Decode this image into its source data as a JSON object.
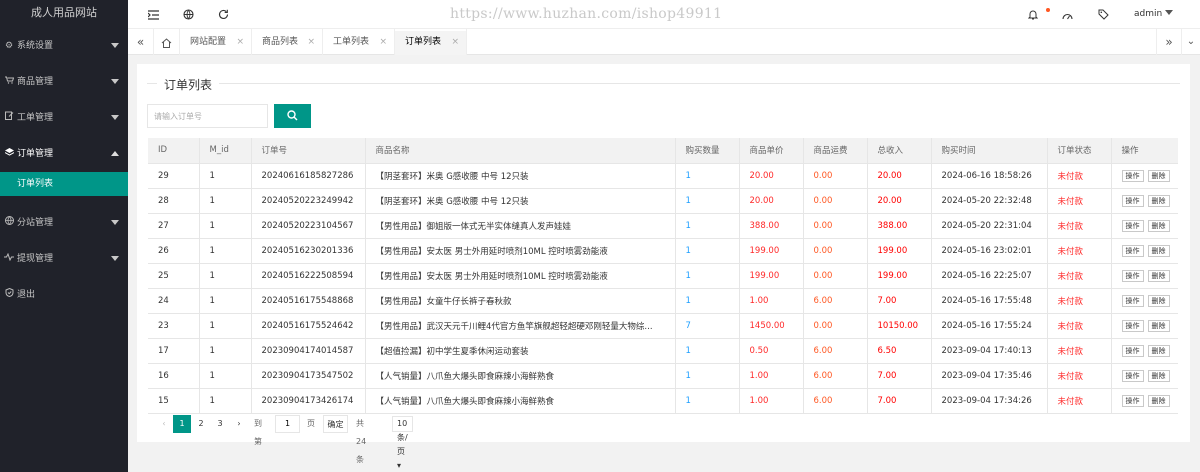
{
  "brand": "成人用品网站",
  "menu": {
    "items": [
      {
        "label": "系统设置",
        "icon": "gear-icon"
      },
      {
        "label": "商品管理",
        "icon": "cart-icon"
      },
      {
        "label": "工单管理",
        "icon": "edit-icon"
      },
      {
        "label": "订单管理",
        "icon": "layers-icon"
      },
      {
        "label": "分站管理",
        "icon": "globe-icon"
      },
      {
        "label": "提现管理",
        "icon": "pulse-icon"
      },
      {
        "label": "退出",
        "icon": "shield-icon"
      }
    ],
    "sub_active": "订单列表"
  },
  "header": {
    "watermark": "https://www.huzhan.com/ishop49911",
    "user": "admin"
  },
  "tabs": [
    {
      "label": "网站配置"
    },
    {
      "label": "商品列表"
    },
    {
      "label": "工单列表"
    },
    {
      "label": "订单列表"
    }
  ],
  "panel": {
    "legend": "订单列表",
    "search_placeholder": "请输入订单号"
  },
  "table": {
    "columns": [
      "ID",
      "M_id",
      "订单号",
      "商品名称",
      "购买数量",
      "商品单价",
      "商品运费",
      "总收入",
      "购买时间",
      "订单状态",
      "操作"
    ],
    "op_label": "操作",
    "del_label": "删除",
    "rows": [
      {
        "id": "29",
        "mid": "1",
        "order": "20240616185827286",
        "name": "【阴茎套环】米奥 G感收腰 中号 12只装",
        "qty": "1",
        "price": "20.00",
        "fee": "0.00",
        "total": "20.00",
        "time": "2024-06-16 18:58:26",
        "status": "未付款"
      },
      {
        "id": "28",
        "mid": "1",
        "order": "20240520223249942",
        "name": "【阴茎套环】米奥 G感收腰 中号 12只装",
        "qty": "1",
        "price": "20.00",
        "fee": "0.00",
        "total": "20.00",
        "time": "2024-05-20 22:32:48",
        "status": "未付款"
      },
      {
        "id": "27",
        "mid": "1",
        "order": "20240520223104567",
        "name": "【男性用品】御姐版一体式无半实体缝真人发声娃娃",
        "qty": "1",
        "price": "388.00",
        "fee": "0.00",
        "total": "388.00",
        "time": "2024-05-20 22:31:04",
        "status": "未付款"
      },
      {
        "id": "26",
        "mid": "1",
        "order": "20240516230201336",
        "name": "【男性用品】安太医 男士外用延时喷剂10ML 控时喷雾劲能液",
        "qty": "1",
        "price": "199.00",
        "fee": "0.00",
        "total": "199.00",
        "time": "2024-05-16 23:02:01",
        "status": "未付款"
      },
      {
        "id": "25",
        "mid": "1",
        "order": "20240516222508594",
        "name": "【男性用品】安太医 男士外用延时喷剂10ML 控时喷雾劲能液",
        "qty": "1",
        "price": "199.00",
        "fee": "0.00",
        "total": "199.00",
        "time": "2024-05-16 22:25:07",
        "status": "未付款"
      },
      {
        "id": "24",
        "mid": "1",
        "order": "20240516175548868",
        "name": "【男性用品】女童牛仔长裤子春秋款",
        "qty": "1",
        "price": "1.00",
        "fee": "6.00",
        "total": "7.00",
        "time": "2024-05-16 17:55:48",
        "status": "未付款"
      },
      {
        "id": "23",
        "mid": "1",
        "order": "20240516175524642",
        "name": "【男性用品】武汉天元千川鲤4代官方鱼竿旗舰超轻超硬邓刚轻量大物综...",
        "qty": "7",
        "price": "1450.00",
        "fee": "0.00",
        "total": "10150.00",
        "time": "2024-05-16 17:55:24",
        "status": "未付款"
      },
      {
        "id": "17",
        "mid": "1",
        "order": "20230904174014587",
        "name": "【超值捡漏】初中学生夏季休闲运动套装",
        "qty": "1",
        "price": "0.50",
        "fee": "6.00",
        "total": "6.50",
        "time": "2023-09-04 17:40:13",
        "status": "未付款"
      },
      {
        "id": "16",
        "mid": "1",
        "order": "20230904173547502",
        "name": "【人气销量】八爪鱼大爆头即食麻辣小海鲜熟食",
        "qty": "1",
        "price": "1.00",
        "fee": "6.00",
        "total": "7.00",
        "time": "2023-09-04 17:35:46",
        "status": "未付款"
      },
      {
        "id": "15",
        "mid": "1",
        "order": "20230904173426174",
        "name": "【人气销量】八爪鱼大爆头即食麻辣小海鲜熟食",
        "qty": "1",
        "price": "1.00",
        "fee": "6.00",
        "total": "7.00",
        "time": "2023-09-04 17:34:26",
        "status": "未付款"
      }
    ]
  },
  "pager": {
    "pages": [
      "1",
      "2",
      "3"
    ],
    "goto_label": "到第",
    "page_value": "1",
    "page_unit": "页",
    "confirm": "确定",
    "total": "共 24 条",
    "per_page": "10 条/页"
  }
}
